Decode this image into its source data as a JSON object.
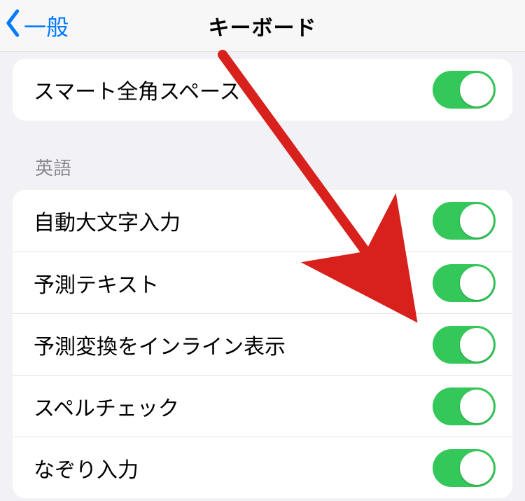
{
  "nav": {
    "back_label": "一般",
    "title": "キーボード"
  },
  "section1": {
    "smart_full_space": {
      "label": "スマート全角スペース",
      "on": true
    }
  },
  "section2": {
    "header": "英語",
    "auto_caps": {
      "label": "自動大文字入力",
      "on": true
    },
    "predictive_text": {
      "label": "予測テキスト",
      "on": true
    },
    "inline_predictions": {
      "label": "予測変換をインライン表示",
      "on": true
    },
    "spell_check": {
      "label": "スペルチェック",
      "on": true
    },
    "slide_to_type": {
      "label": "なぞり入力",
      "on": true
    }
  },
  "colors": {
    "toggle_on": "#34c759",
    "link": "#007aff"
  }
}
